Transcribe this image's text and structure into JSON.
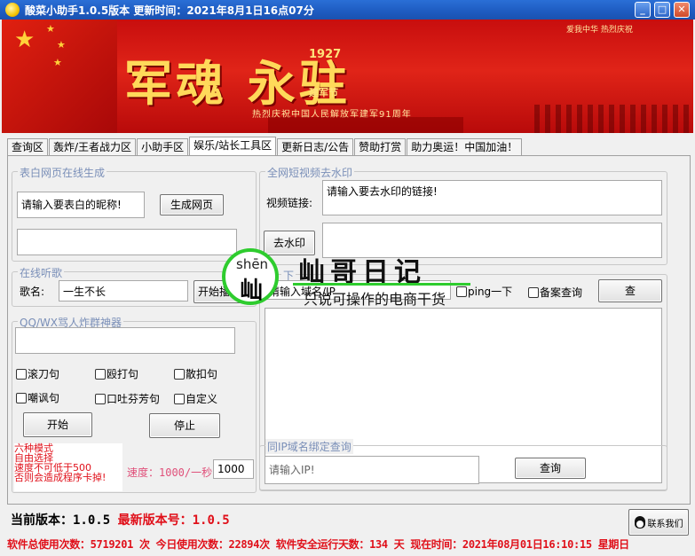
{
  "window": {
    "title": "酸菜小助手1.0.5版本    更新时间：2021年8月1日16点07分",
    "minimize_icon": "_",
    "maximize_icon": "□",
    "close_icon": "✕"
  },
  "banner": {
    "headline": "军魂 永驻",
    "badge_top": "1927",
    "badge_bottom": "建军节",
    "subtitle": "热烈庆祝中国人民解放军建军91周年",
    "top_right": "爱我中华  热烈庆祝"
  },
  "tabs": [
    "查询区",
    "轰炸/王者战力区",
    "小助手区",
    "娱乐/站长工具区",
    "更新日志/公告",
    "赞助打赏",
    "助力奥运！中国加油！"
  ],
  "active_tab_index": 3,
  "confession": {
    "group_title": "表白网页在线生成",
    "nickname_placeholder": "请输入要表白的昵称!",
    "generate_button": "生成网页"
  },
  "video": {
    "group_title": "全网短视频去水印",
    "link_label": "视频链接:",
    "link_placeholder": "请输入要去水印的链接!",
    "remove_button": "去水印"
  },
  "music": {
    "group_title": "在线听歌",
    "song_label": "歌名:",
    "song_value": "一生不长",
    "play_button": "开始播放"
  },
  "tools": {
    "group_title": "下",
    "domain_placeholder": "请输入域名/IP",
    "ping_label": "ping一下",
    "beian_checkbox": "备案查询",
    "query_button": "查"
  },
  "spam": {
    "group_title": "QQ/WX骂人炸群神器",
    "options": [
      "滚刀句",
      "殴打句",
      "散扣句",
      "嘲讽句",
      "口吐芬芳句",
      "自定义"
    ],
    "start_button": "开始",
    "stop_button": "停止",
    "warning": [
      "六种模式",
      "自由选择",
      "速度不可低于500",
      "否则会造成程序卡掉!"
    ],
    "speed_label": "速度：1000/一秒",
    "speed_value": "1000"
  },
  "same_ip": {
    "group_title": "同IP域名绑定查询",
    "ip_placeholder": "请输入IP!",
    "query_button": "查询"
  },
  "watermark": {
    "pinyin": "shēn",
    "char": "屾",
    "title": "屾哥日记",
    "slogan": "只说可操作的电商干货"
  },
  "version": {
    "current": "当前版本：1.0.5",
    "latest": "最新版本号：1.0.5"
  },
  "contact_button": "联系我们",
  "status": "软件总使用次数：5719201 次  今日使用次数：22894次  软件安全运行天数：134 天  现在时间：2021年08月01日16:10:15  星期日",
  "colors": {
    "titlebar": "#1e5bc0",
    "banner_red": "#d41414",
    "alert_red": "#e0101a",
    "group_title": "#7a8fb8"
  }
}
